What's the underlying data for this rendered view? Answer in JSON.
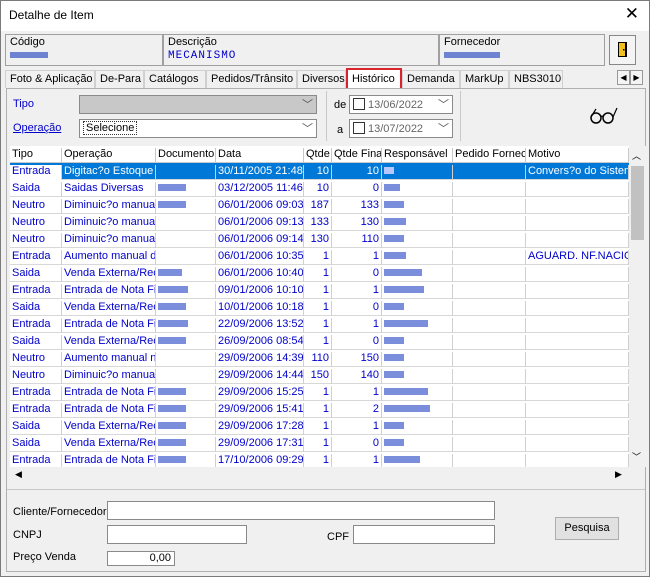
{
  "window": {
    "title": "Detalhe de Item",
    "close_glyph": "✕"
  },
  "header": {
    "codigo_label": "Código",
    "descricao_label": "Descrição",
    "descricao_value": "MECANISMO",
    "fornecedor_label": "Fornecedor"
  },
  "tabs": [
    {
      "label": "Foto & Aplicação",
      "active": false
    },
    {
      "label": "De-Para",
      "active": false
    },
    {
      "label": "Catálogos",
      "active": false
    },
    {
      "label": "Pedidos/Trânsito",
      "active": false
    },
    {
      "label": "Diversos",
      "active": false
    },
    {
      "label": "Histórico",
      "active": true
    },
    {
      "label": "Demanda",
      "active": false
    },
    {
      "label": "MarkUp",
      "active": false
    },
    {
      "label": "NBS3010",
      "active": false
    }
  ],
  "filters": {
    "tipo_label": "Tipo",
    "operacao_label": "Operação",
    "operacao_value": "Selecione",
    "de_label": "de",
    "a_label": "a",
    "date_from": "13/06/2022",
    "date_to": "13/07/2022",
    "glasses_icon": "glasses-icon"
  },
  "grid": {
    "columns": [
      "Tipo",
      "Operação",
      "Documento",
      "Data",
      "Qtde",
      "Qtde Final",
      "Responsável",
      "Pedido Fornec",
      "Motivo"
    ],
    "rows": [
      {
        "tipo": "Entrada",
        "operacao": "Digitac?o Estoque",
        "data": "30/11/2005 21:48",
        "qtde": "10",
        "qfinal": "10",
        "motivo": "Convers?o do Sistema",
        "selected": true
      },
      {
        "tipo": "Saida",
        "operacao": "Saidas Diversas",
        "data": "03/12/2005 11:46",
        "qtde": "10",
        "qfinal": "0",
        "motivo": ""
      },
      {
        "tipo": "Neutro",
        "operacao": "Diminuic?o manual",
        "data": "06/01/2006 09:03",
        "qtde": "187",
        "qfinal": "133",
        "motivo": ""
      },
      {
        "tipo": "Neutro",
        "operacao": "Diminuic?o manual",
        "data": "06/01/2006 09:13",
        "qtde": "133",
        "qfinal": "130",
        "motivo": ""
      },
      {
        "tipo": "Neutro",
        "operacao": "Diminuic?o manual",
        "data": "06/01/2006 09:14",
        "qtde": "130",
        "qfinal": "110",
        "motivo": ""
      },
      {
        "tipo": "Entrada",
        "operacao": "Aumento manual de",
        "data": "06/01/2006 10:35",
        "qtde": "1",
        "qfinal": "1",
        "motivo": "AGUARD. NF.NACIO"
      },
      {
        "tipo": "Saida",
        "operacao": "Venda Externa/Rec",
        "data": "06/01/2006 10:40",
        "qtde": "1",
        "qfinal": "0",
        "motivo": ""
      },
      {
        "tipo": "Entrada",
        "operacao": "Entrada de Nota Fis",
        "data": "09/01/2006 10:10",
        "qtde": "1",
        "qfinal": "1",
        "motivo": ""
      },
      {
        "tipo": "Saida",
        "operacao": "Venda Externa/Rec",
        "data": "10/01/2006 10:18",
        "qtde": "1",
        "qfinal": "0",
        "motivo": ""
      },
      {
        "tipo": "Entrada",
        "operacao": "Entrada de Nota Fis",
        "data": "22/09/2006 13:52",
        "qtde": "1",
        "qfinal": "1",
        "motivo": ""
      },
      {
        "tipo": "Saida",
        "operacao": "Venda Externa/Rec",
        "data": "26/09/2006 08:54",
        "qtde": "1",
        "qfinal": "0",
        "motivo": ""
      },
      {
        "tipo": "Neutro",
        "operacao": "Aumento manual nc",
        "data": "29/09/2006 14:39",
        "qtde": "110",
        "qfinal": "150",
        "motivo": ""
      },
      {
        "tipo": "Neutro",
        "operacao": "Diminuic?o manual",
        "data": "29/09/2006 14:44",
        "qtde": "150",
        "qfinal": "140",
        "motivo": ""
      },
      {
        "tipo": "Entrada",
        "operacao": "Entrada de Nota Fis",
        "data": "29/09/2006 15:25",
        "qtde": "1",
        "qfinal": "1",
        "motivo": ""
      },
      {
        "tipo": "Entrada",
        "operacao": "Entrada de Nota Fis",
        "data": "29/09/2006 15:41",
        "qtde": "1",
        "qfinal": "2",
        "motivo": ""
      },
      {
        "tipo": "Saida",
        "operacao": "Venda Externa/Rec",
        "data": "29/09/2006 17:28",
        "qtde": "1",
        "qfinal": "1",
        "motivo": ""
      },
      {
        "tipo": "Saida",
        "operacao": "Venda Externa/Rec",
        "data": "29/09/2006 17:31",
        "qtde": "1",
        "qfinal": "0",
        "motivo": ""
      },
      {
        "tipo": "Entrada",
        "operacao": "Entrada de Nota Fis",
        "data": "17/10/2006 09:29",
        "qtde": "1",
        "qfinal": "1",
        "motivo": ""
      }
    ]
  },
  "bottom": {
    "cliente_label": "Cliente/Fornecedor",
    "cnpj_label": "CNPJ",
    "cpf_label": "CPF",
    "preco_label": "Preço Venda",
    "preco_value": "0,00",
    "pesquisa_label": "Pesquisa"
  }
}
